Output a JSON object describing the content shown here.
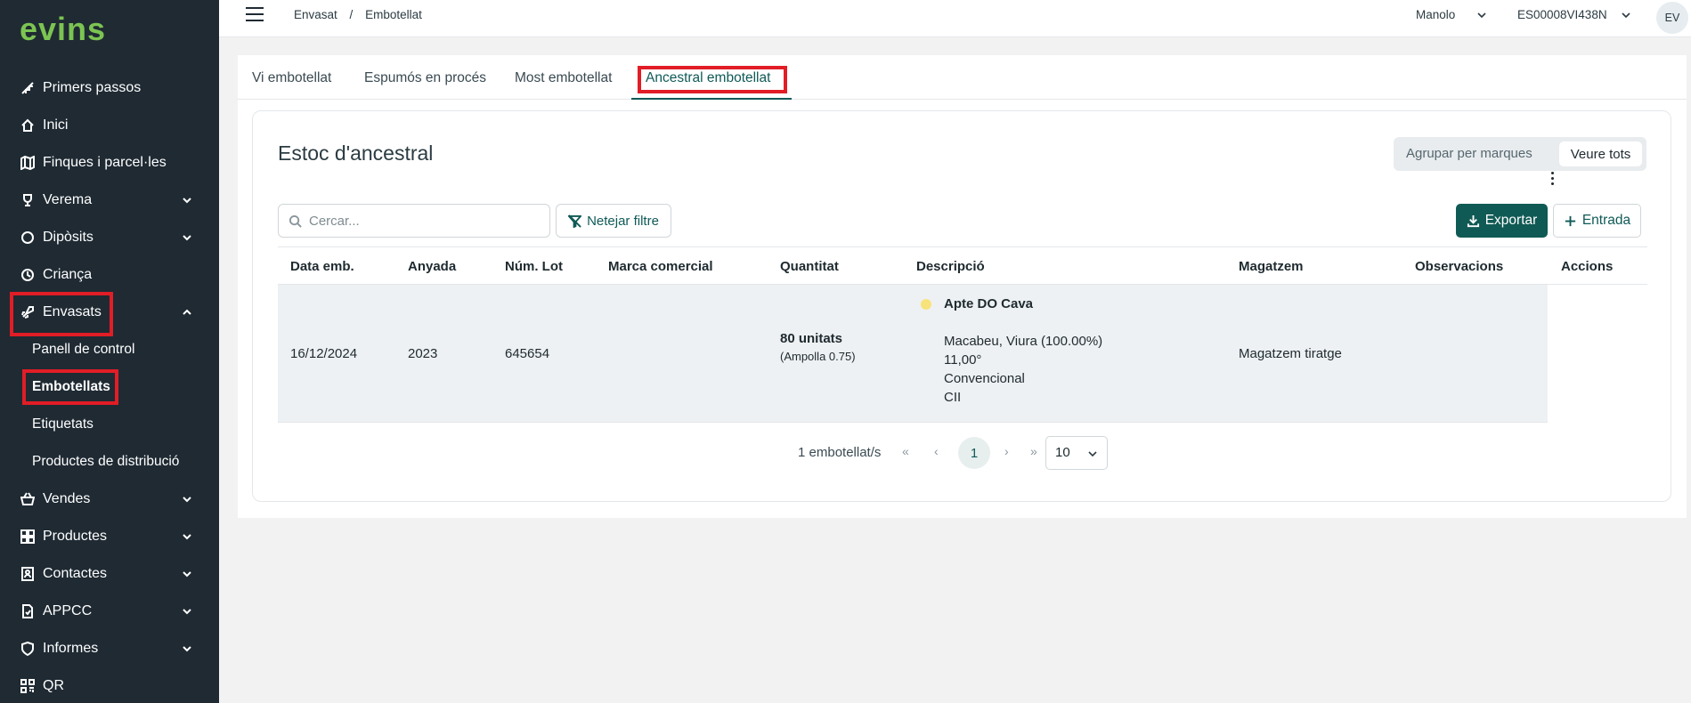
{
  "brand": {
    "logo_prefix": "e",
    "logo_rest": "vins",
    "accent": "#7cc452"
  },
  "sidebar": {
    "items": [
      {
        "label": "Primers passos",
        "icon": "steps-icon"
      },
      {
        "label": "Inici",
        "icon": "home-icon"
      },
      {
        "label": "Finques i parcel·les",
        "icon": "map-icon"
      },
      {
        "label": "Verema",
        "icon": "trophy-icon"
      },
      {
        "label": "Dipòsits",
        "icon": "circle-icon"
      },
      {
        "label": "Criança",
        "icon": "clock-icon"
      },
      {
        "label": "Envasats",
        "icon": "rocket-icon"
      }
    ],
    "subitems": [
      {
        "label": "Panell de control"
      },
      {
        "label": "Embotellats"
      },
      {
        "label": "Etiquetats"
      },
      {
        "label": "Productes de distribució"
      }
    ],
    "items_after": [
      {
        "label": "Vendes",
        "icon": "basket-icon"
      },
      {
        "label": "Productes",
        "icon": "grid-icon"
      },
      {
        "label": "Contactes",
        "icon": "contacts-icon"
      },
      {
        "label": "APPCC",
        "icon": "document-icon"
      },
      {
        "label": "Informes",
        "icon": "shield-icon"
      },
      {
        "label": "QR",
        "icon": "qr-icon"
      }
    ]
  },
  "topbar": {
    "breadcrumb": [
      "Envasat",
      "Embotellat"
    ],
    "user": "Manolo",
    "code": "ES00008VI438N",
    "avatar": "EV"
  },
  "tabs": [
    "Vi embotellat",
    "Espumós en procés",
    "Most embotellat",
    "Ancestral embotellat"
  ],
  "panel": {
    "title": "Estoc d'ancestral",
    "toggle": [
      "Agrupar per marques",
      "Veure tots"
    ],
    "search_placeholder": "Cercar...",
    "clear_filter": "Netejar filtre",
    "export": "Exportar",
    "entry": "Entrada"
  },
  "table": {
    "headers": [
      "Data emb.",
      "Anyada",
      "Núm. Lot",
      "Marca comercial",
      "Quantitat",
      "Descripció",
      "Magatzem",
      "Observacions",
      "Accions"
    ],
    "row": {
      "date": "16/12/2024",
      "year": "2023",
      "lot": "645654",
      "brand": "",
      "qty": "80 unitats",
      "qty_sub": "(Ampolla 0.75)",
      "desc_title": "Apte DO Cava",
      "desc_variety": "Macabeu, Viura (100.00%)",
      "desc_degree": "11,00°",
      "desc_type": "Convencional",
      "desc_code": "CII",
      "warehouse": "Magatzem tiratge",
      "notes": ""
    }
  },
  "pagination": {
    "count": "1 embotellat/s",
    "first": "«",
    "prev": "‹",
    "page": "1",
    "next": "›",
    "last": "»",
    "size": "10"
  }
}
